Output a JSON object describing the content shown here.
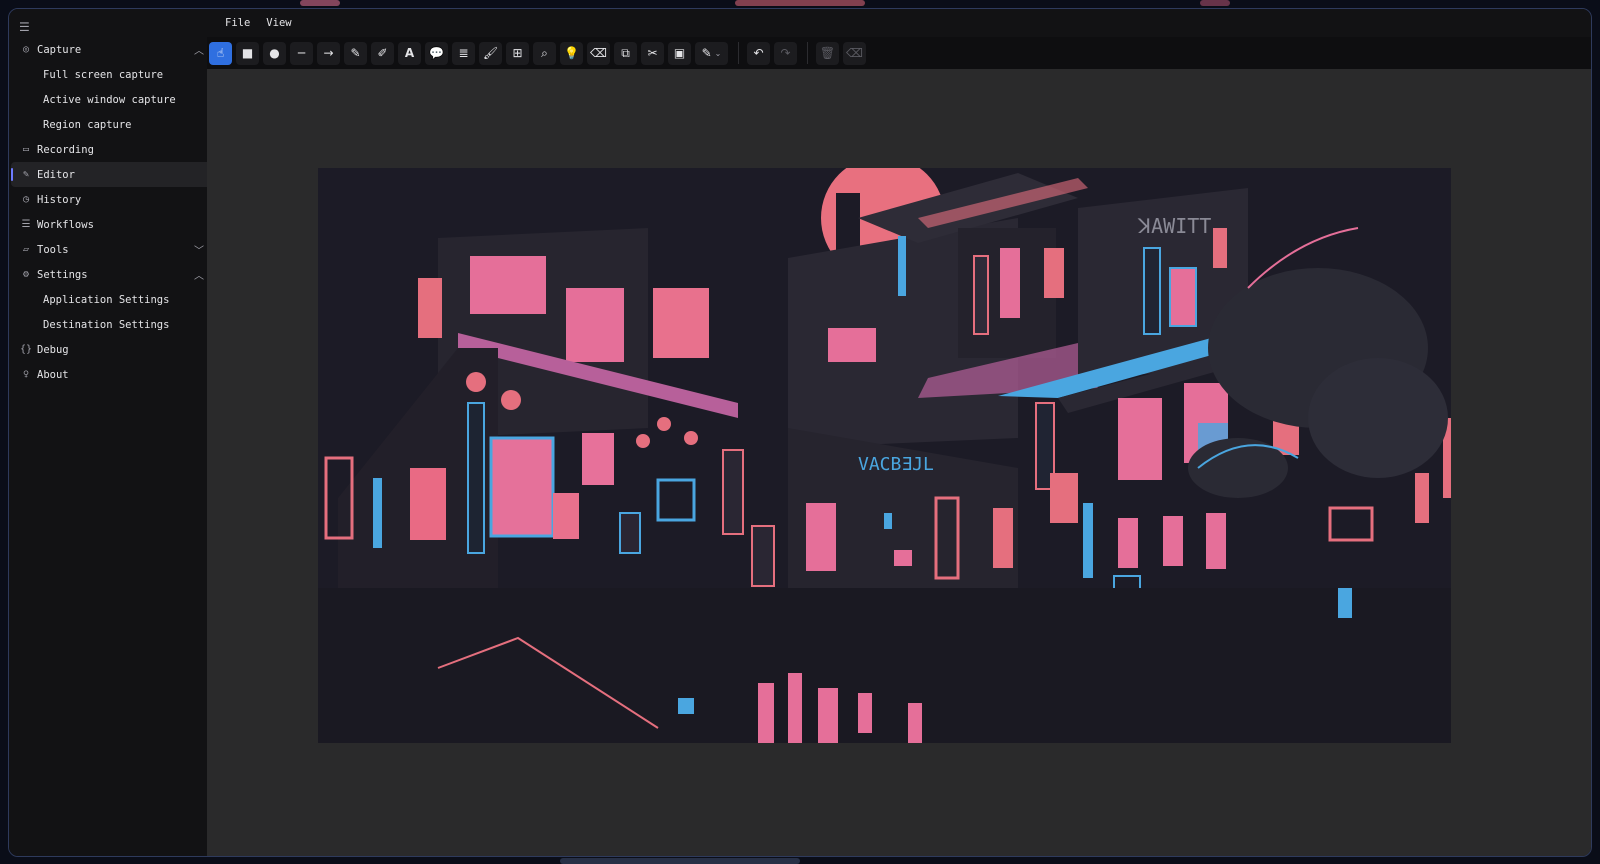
{
  "menubar": {
    "items": [
      "File",
      "View"
    ]
  },
  "sidebar": {
    "menu_icon": "hamburger-icon",
    "items": [
      {
        "label": "Capture",
        "icon": "camera-icon",
        "chevron": "up"
      },
      {
        "label": "Full screen capture",
        "sub": true
      },
      {
        "label": "Active window capture",
        "sub": true
      },
      {
        "label": "Region capture",
        "sub": true
      },
      {
        "label": "Recording",
        "icon": "video-icon"
      },
      {
        "label": "Editor",
        "icon": "pencil-icon",
        "active": true
      },
      {
        "label": "History",
        "icon": "clock-icon"
      },
      {
        "label": "Workflows",
        "icon": "list-icon"
      },
      {
        "label": "Tools",
        "icon": "folder-icon",
        "chevron": "down"
      },
      {
        "label": "Settings",
        "icon": "gear-icon",
        "chevron": "up"
      },
      {
        "label": "Application Settings",
        "sub": true
      },
      {
        "label": "Destination Settings",
        "sub": true
      },
      {
        "label": "Debug",
        "icon": "braces-icon"
      },
      {
        "label": "About",
        "icon": "lightbulb-icon"
      }
    ]
  },
  "toolbar": {
    "tools": [
      "pointer",
      "rectangle",
      "ellipse",
      "line",
      "arrow",
      "pen",
      "highlighter",
      "text",
      "speech-bubble",
      "numbered-step",
      "brush",
      "grid",
      "magnifier",
      "spotlight",
      "eraser",
      "crop",
      "cut",
      "image",
      "color-picker"
    ],
    "active_tool": "pointer",
    "actions": [
      "undo",
      "redo",
      "delete",
      "clear"
    ]
  },
  "colors": {
    "accent": "#2f6fe0",
    "window_border": "#2e3a5c",
    "art_pink": "#e76d8f",
    "art_blue": "#4aa6e0"
  }
}
